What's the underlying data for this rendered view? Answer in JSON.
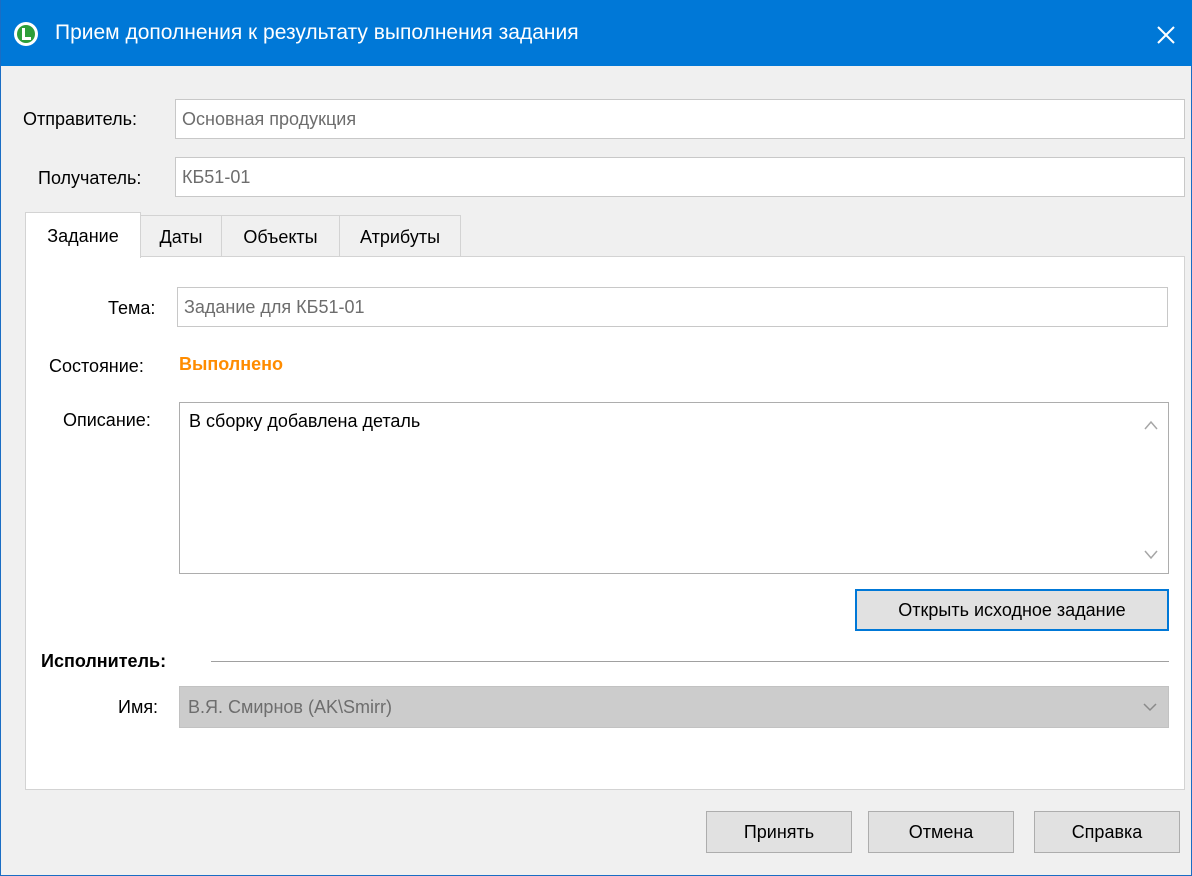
{
  "window": {
    "title": "Прием дополнения к результату выполнения задания",
    "accent_color": "#0078d7",
    "app_icon": "app-logo-icon",
    "close_icon": "close-icon"
  },
  "sender": {
    "label": "Отправитель:",
    "value": "Основная продукция"
  },
  "recipient": {
    "label": "Получатель:",
    "value": "КБ51-01"
  },
  "tabs": [
    {
      "label": "Задание",
      "active": true
    },
    {
      "label": "Даты",
      "active": false
    },
    {
      "label": "Объекты",
      "active": false
    },
    {
      "label": "Атрибуты",
      "active": false
    }
  ],
  "task": {
    "subject_label": "Тема:",
    "subject_value": "Задание для КБ51-01",
    "state_label": "Состояние:",
    "state_value": "Выполнено",
    "state_color": "#ff8c00",
    "description_label": "Описание:",
    "description_value": "В сборку добавлена деталь",
    "open_original_button": "Открыть исходное задание"
  },
  "executor": {
    "group_label": "Исполнитель:",
    "name_label": "Имя:",
    "name_value": "В.Я. Смирнов (AK\\Smirr)"
  },
  "footer": {
    "accept_button": "Принять",
    "cancel_button": "Отмена",
    "help_button": "Справка"
  }
}
